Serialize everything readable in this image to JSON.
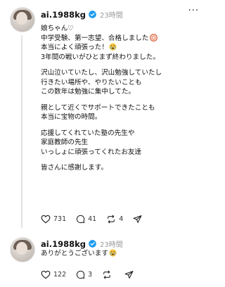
{
  "post1": {
    "username": "ai.1988kg",
    "time": "23時間",
    "paragraphs": [
      [
        "娘ちゃん♡",
        "中学受験、第一志望、合格しました",
        "本当によく頑張った！",
        "3年間の戦いがひとまず終わりました。"
      ],
      [
        "沢山泣いていたし、沢山勉強していたし",
        "行きたい場所や、やりたいことも",
        "この数年は勉強に集中してた。"
      ],
      [
        "親として近くでサポートできたことも",
        "本当に宝物の時間。"
      ],
      [
        "応援してくれていた塾の先生や",
        "家庭教師の先生",
        "いっしょに頑張ってくれたお友達"
      ],
      [
        "皆さんに感謝します。"
      ]
    ],
    "actions": {
      "likes": "731",
      "comments": "41",
      "reposts": "4"
    }
  },
  "post2": {
    "username": "ai.1988kg",
    "time": "23時間",
    "text": "ありがとうございます",
    "actions": {
      "likes": "122",
      "comments": "3"
    }
  },
  "icons": {
    "verified": "verified-badge-icon",
    "like": "heart-icon",
    "comment": "comment-bubble-icon",
    "repost": "repost-icon",
    "share": "share-paper-plane-icon",
    "more": "more-options-icon",
    "emoji_cry": "crying-face-emoji",
    "emoji_seal": "round-seal-emoji"
  },
  "colors": {
    "verified": "#1d9bf0",
    "muted": "#9a9a9a",
    "text": "#111111"
  }
}
